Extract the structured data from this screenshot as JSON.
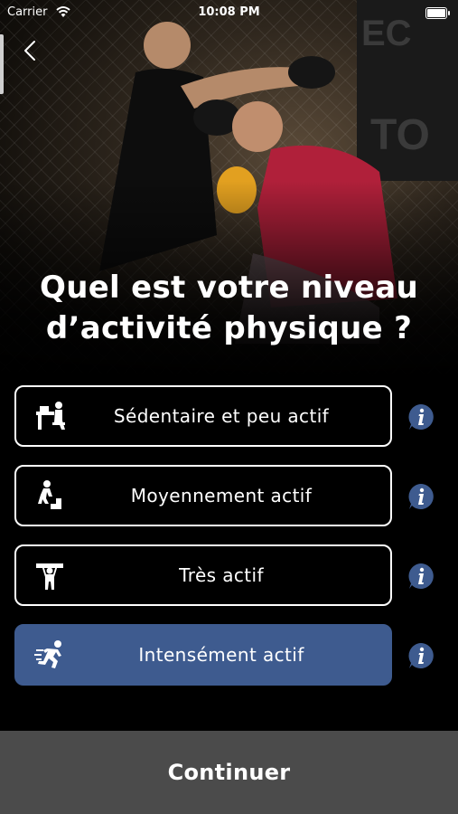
{
  "status_bar": {
    "carrier": "Carrier",
    "time": "10:08 PM"
  },
  "question": {
    "line1": "Quel est votre niveau",
    "line2": "d’activité physique ?"
  },
  "options": [
    {
      "label": "Sédentaire et peu actif",
      "icon": "desk-sitting-icon",
      "selected": false
    },
    {
      "label": "Moyennement actif",
      "icon": "stair-climbing-icon",
      "selected": false
    },
    {
      "label": "Très actif",
      "icon": "lifting-person-icon",
      "selected": false
    },
    {
      "label": "Intensément actif",
      "icon": "running-person-icon",
      "selected": true
    }
  ],
  "info_icon": "info-bubble-icon",
  "continue_label": "Continuer",
  "colors": {
    "selected": "#3e5b8f",
    "info": "#3e5b8f",
    "bottom_bar": "#4b4b4b"
  }
}
